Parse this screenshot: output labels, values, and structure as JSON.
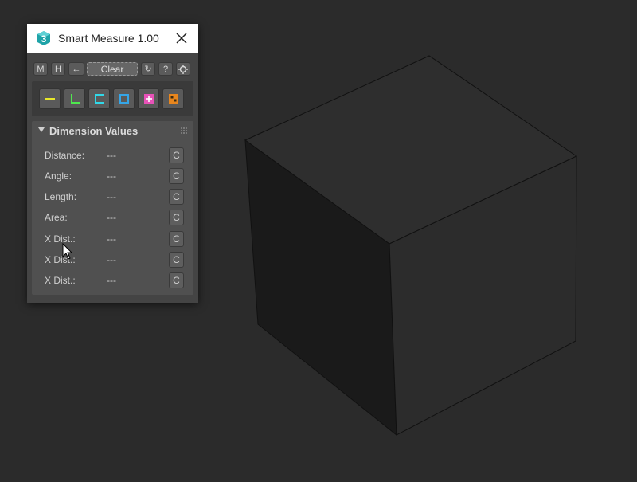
{
  "window": {
    "title": "Smart Measure 1.00",
    "app_icon_label": "3"
  },
  "toolbar": {
    "measure_label": "M",
    "history_label": "H",
    "back_label": "←",
    "clear_label": "Clear",
    "refresh_label": "↻",
    "help_label": "?"
  },
  "tools": [
    {
      "icon": "line-measure-icon",
      "color": "#e8e82a"
    },
    {
      "icon": "angle-measure-icon",
      "color": "#4ee84e"
    },
    {
      "icon": "length-measure-icon",
      "color": "#31d8e8"
    },
    {
      "icon": "area-measure-icon",
      "color": "#35a6e8"
    },
    {
      "icon": "add-point-icon",
      "color": "#e852b8"
    },
    {
      "icon": "grid-point-icon",
      "color": "#e8861e"
    }
  ],
  "rollout": {
    "title": "Dimension Values",
    "rows": [
      {
        "label": "Distance:",
        "value": "---",
        "button": "C"
      },
      {
        "label": "Angle:",
        "value": "---",
        "button": "C"
      },
      {
        "label": "Length:",
        "value": "---",
        "button": "C"
      },
      {
        "label": "Area:",
        "value": "---",
        "button": "C"
      },
      {
        "label": "X Dist.:",
        "value": "---",
        "button": "C"
      },
      {
        "label": "X Dist.:",
        "value": "---",
        "button": "C"
      },
      {
        "label": "X Dist.:",
        "value": "---",
        "button": "C"
      }
    ]
  },
  "colors": {
    "viewport_bg": "#2b2b2b",
    "cube_top": "#2e2e2e",
    "cube_left": "#1a1a1a",
    "cube_right": "#2c2c2c"
  }
}
